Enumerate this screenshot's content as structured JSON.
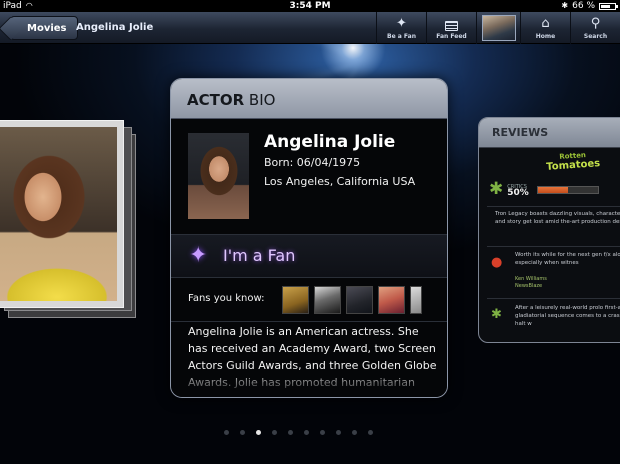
{
  "status_bar": {
    "device": "iPad",
    "time": "3:54 PM",
    "battery": "66 %"
  },
  "nav": {
    "back_label": "Movies",
    "title": "Angelina Jolie",
    "buttons": [
      {
        "label": "Be a Fan",
        "icon": "sparkle-icon"
      },
      {
        "label": "Fan Feed",
        "icon": "feed-icon"
      },
      {
        "label": "",
        "icon": "profile-photo-icon"
      },
      {
        "label": "Home",
        "icon": "home-icon"
      },
      {
        "label": "Search",
        "icon": "search-icon"
      }
    ]
  },
  "bio_card": {
    "title_bold": "ACTOR",
    "title_rest": " BIO",
    "name": "Angelina Jolie",
    "born": "Born: 06/04/1975",
    "birthplace": "Los Angeles, California USA",
    "fan_label": "I'm a Fan",
    "fans_label": "Fans you know:",
    "bio_text": "Angelina Jolie is an American actress. She has received an Academy Award, two Screen Actors Guild Awards, and three Golden Globe Awards. Jolie has promoted humanitarian"
  },
  "reviews": {
    "title": "REVIEWS",
    "logo_line1": "Rotten",
    "logo_line2": "Tomatoes",
    "critics_label": "CRITICS",
    "critics_score": "50%",
    "score_fraction": 0.5,
    "items": [
      {
        "text": "Tron Legacy boasts dazzling visuals, characters and story get lost amid the-art production design.",
        "author": ""
      },
      {
        "text": "Worth its while for the next gen f/x alone, especially when witnes",
        "author": "Ken Williams NewsBlaze"
      },
      {
        "text": "After a leisurely real-world prolo first-act gladiatorial sequence comes to a crashing halt w",
        "author": ""
      }
    ]
  },
  "pager": {
    "count": 10,
    "active": 2
  }
}
